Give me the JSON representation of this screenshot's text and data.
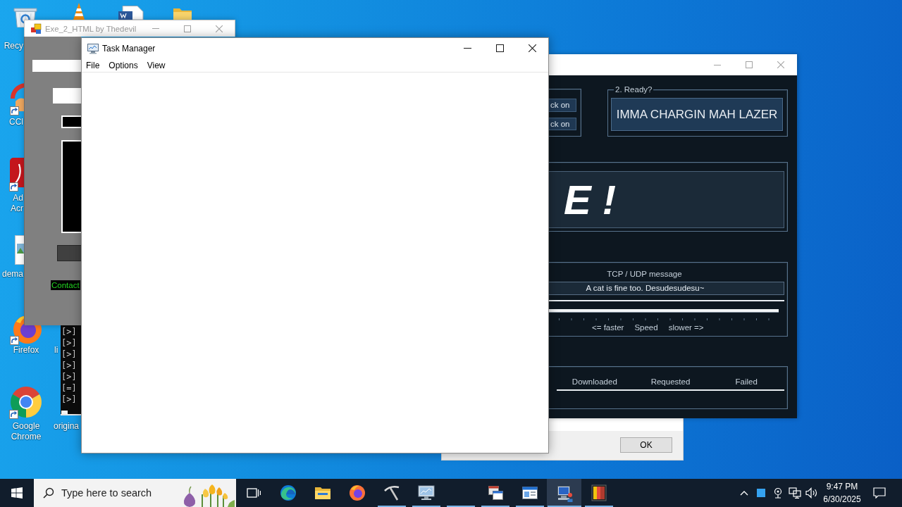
{
  "desktop": {
    "icons": [
      {
        "label": "Recy"
      },
      {
        "label": "CCl"
      },
      {
        "label": "Ad Acr"
      },
      {
        "label": "dema"
      },
      {
        "label": "Firefox"
      },
      {
        "label": "li"
      },
      {
        "label": "Google Chrome"
      },
      {
        "label": "origina"
      }
    ]
  },
  "exe2html_window": {
    "title": "Exe_2_HTML by Thedevil",
    "active": false,
    "contact_link": "Contact"
  },
  "task_manager": {
    "title": "Task Manager",
    "active": true,
    "menu": [
      "File",
      "Options",
      "View"
    ]
  },
  "loic_window": {
    "active": false,
    "lock_buttons": [
      "ck on",
      "ck on"
    ],
    "ready_group": {
      "legend": "2. Ready?",
      "button": "IMMA CHARGIN MAH LAZER"
    },
    "target_display": "E !",
    "message": {
      "label": "TCP / UDP message",
      "value": "A cat is fine too. Desudesudesu~"
    },
    "speed_labels": [
      "<= faster",
      "Speed",
      "slower =>"
    ],
    "status_columns": [
      "Downloaded",
      "Requested",
      "Failed"
    ]
  },
  "console_window": {
    "lines": [
      "[>]",
      "[>]",
      "[>]",
      "[>]",
      "[>]",
      "[=]",
      "[>]"
    ]
  },
  "message_dialog": {
    "ok_button": "OK"
  },
  "taskbar": {
    "search": {
      "placeholder": "Type here to search"
    },
    "apps": [
      {
        "running": false,
        "selected": false
      },
      {
        "running": false,
        "selected": false
      },
      {
        "running": false,
        "selected": false
      },
      {
        "running": false,
        "selected": false
      },
      {
        "running": true,
        "selected": false
      },
      {
        "running": true,
        "selected": false
      },
      {
        "running": true,
        "selected": false
      },
      {
        "running": true,
        "selected": false
      },
      {
        "running": true,
        "selected": false
      },
      {
        "running": true,
        "selected": true
      },
      {
        "running": true,
        "selected": false
      }
    ],
    "clock": {
      "time": "9:47 PM",
      "date": "6/30/2025"
    }
  }
}
